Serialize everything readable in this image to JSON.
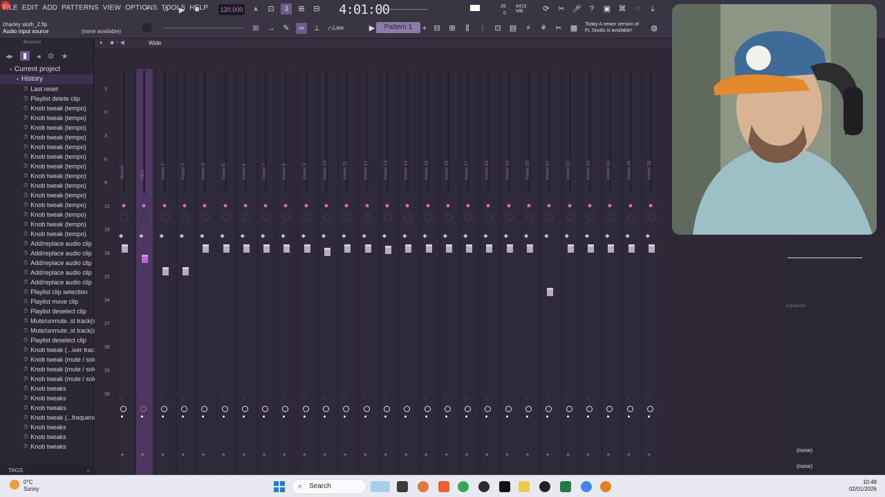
{
  "menu": [
    "FILE",
    "EDIT",
    "ADD",
    "PATTERNS",
    "VIEW",
    "OPTIONS",
    "TOOLS",
    "HELP"
  ],
  "project": {
    "file_name": "charley sloth_2.flp",
    "input_source": "Audio input source",
    "none_available": "(none available)"
  },
  "transport": {
    "tempo": "120.000",
    "time": "4:01:00",
    "cpu": "26",
    "memory": "6415 MB",
    "poly": "0"
  },
  "snap": "Line",
  "pattern": "Pattern 1",
  "update_notice": {
    "line1": "Today  A newer version of",
    "line2": "FL Studio is available!"
  },
  "browser": {
    "header": "Browser",
    "root": "Current project",
    "history": "History",
    "items": [
      "Last reset",
      "Playlist delete clip",
      "Knob tweak (tempo)",
      "Knob tweak (tempo)",
      "Knob tweak (tempo)",
      "Knob tweak (tempo)",
      "Knob tweak (tempo)",
      "Knob tweak (tempo)",
      "Knob tweak (tempo)",
      "Knob tweak (tempo)",
      "Knob tweak (tempo)",
      "Knob tweak (tempo)",
      "Knob tweak (tempo)",
      "Knob tweak (tempo)",
      "Knob tweak (tempo)",
      "Knob tweak (tempo)",
      "Add/replace audio clip",
      "Add/replace audio clip",
      "Add/replace audio clip",
      "Add/replace audio clip",
      "Add/replace audio clip",
      "Playlist clip selection",
      "Playlist move clip",
      "Playlist deselect clip",
      "Mute/unmute..st track(s)",
      "Mute/unmute..st track(s)",
      "Playlist deselect clip",
      "Knob tweak (...ixer track)",
      "Knob tweak (mute / solo)",
      "Knob tweak (mute / solo)",
      "Knob tweak (mute / solo)",
      "Knob tweaks",
      "Knob tweaks",
      "Knob tweaks",
      "Knob tweak (...frequency)",
      "Knob tweaks",
      "Knob tweaks",
      "Knob tweaks"
    ],
    "footer": "TAGS"
  },
  "mixer": {
    "view_mode": "Wide",
    "db_labels": [
      "3",
      "0",
      "3",
      "6",
      "9",
      "12",
      "15",
      "18",
      "21",
      "24",
      "27",
      "30",
      "33",
      "36"
    ],
    "tracks": [
      {
        "name": "Master",
        "fader_level": 0.72,
        "current": false
      },
      {
        "name": "REC",
        "fader_level": 0.62,
        "current": true
      },
      {
        "name": "Insert 2",
        "fader_level": 0.5,
        "current": false
      },
      {
        "name": "Insert 3",
        "fader_level": 0.5,
        "current": false
      },
      {
        "name": "Insert 4",
        "fader_level": 0.72,
        "current": false
      },
      {
        "name": "Insert 5",
        "fader_level": 0.72,
        "current": false
      },
      {
        "name": "Insert 6",
        "fader_level": 0.72,
        "current": false
      },
      {
        "name": "Insert 7",
        "fader_level": 0.72,
        "current": false
      },
      {
        "name": "Insert 8",
        "fader_level": 0.72,
        "current": false
      },
      {
        "name": "Insert 9",
        "fader_level": 0.72,
        "current": false
      },
      {
        "name": "Insert 10",
        "fader_level": 0.69,
        "current": false
      },
      {
        "name": "Insert 11",
        "fader_level": 0.72,
        "current": false
      },
      {
        "name": "Insert 12",
        "fader_level": 0.72,
        "current": false
      },
      {
        "name": "Insert 13",
        "fader_level": 0.71,
        "current": false
      },
      {
        "name": "Insert 14",
        "fader_level": 0.72,
        "current": false
      },
      {
        "name": "Insert 15",
        "fader_level": 0.72,
        "current": false
      },
      {
        "name": "Insert 16",
        "fader_level": 0.72,
        "current": false
      },
      {
        "name": "Insert 17",
        "fader_level": 0.72,
        "current": false
      },
      {
        "name": "Insert 18",
        "fader_level": 0.72,
        "current": false
      },
      {
        "name": "Insert 19",
        "fader_level": 0.72,
        "current": false
      },
      {
        "name": "Insert 20",
        "fader_level": 0.72,
        "current": false
      },
      {
        "name": "Insert 21",
        "fader_level": 0.3,
        "current": false
      },
      {
        "name": "Insert 22",
        "fader_level": 0.72,
        "current": false
      },
      {
        "name": "Insert 23",
        "fader_level": 0.72,
        "current": false
      },
      {
        "name": "Insert 24",
        "fader_level": 0.72,
        "current": false
      },
      {
        "name": "Insert 25",
        "fader_level": 0.72,
        "current": false
      },
      {
        "name": "Insert 26",
        "fader_level": 0.72,
        "current": false
      }
    ]
  },
  "insert_panel": {
    "effect": "Equalizer",
    "slot_1": "(none)",
    "slot_2": "(none)"
  },
  "taskbar": {
    "weather_temp": "0°C",
    "weather_desc": "Sunny",
    "search": "Search",
    "time": "10:48",
    "date": "02/01/2026"
  },
  "colors": {
    "accent": "#8c6cff",
    "current_track": "#4a3860",
    "record": "#d5453a"
  }
}
